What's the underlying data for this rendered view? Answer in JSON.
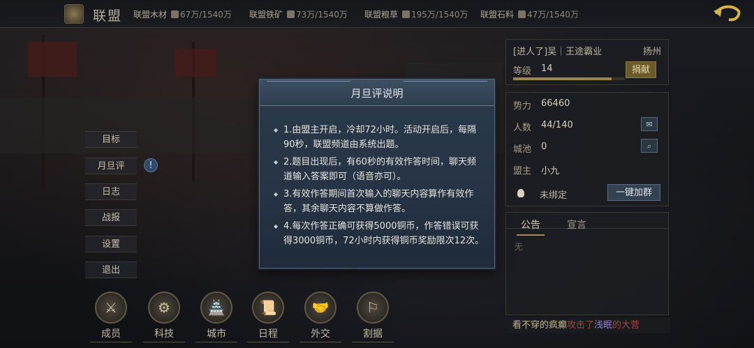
{
  "header": {
    "title": "联盟",
    "resources": [
      {
        "name": "联盟木材",
        "value": "67万/1540万",
        "icon": "wood-icon"
      },
      {
        "name": "联盟铁矿",
        "value": "73万/1540万",
        "icon": "iron-icon"
      },
      {
        "name": "联盟粮草",
        "value": "195万/1540万",
        "icon": "grain-icon"
      },
      {
        "name": "联盟石料",
        "value": "47万/1540万",
        "icon": "stone-icon"
      }
    ]
  },
  "left_menu": [
    "目标",
    "月旦评",
    "日志",
    "战报",
    "设置",
    "退出"
  ],
  "help_bubble": "!",
  "bottom_nav": [
    {
      "label": "成员",
      "glyph": "⚔"
    },
    {
      "label": "科技",
      "glyph": "⚙"
    },
    {
      "label": "城市",
      "glyph": "🏯"
    },
    {
      "label": "日程",
      "glyph": "📜"
    },
    {
      "label": "外交",
      "glyph": "🤝"
    },
    {
      "label": "割据",
      "glyph": "⚐"
    }
  ],
  "alliance": {
    "name": "[进人了]吴｜王途霸业",
    "city": "扬州",
    "level_label": "等级",
    "level": "14",
    "level_progress": 0.88,
    "donate": "捐献",
    "power_label": "势力",
    "power": "66460",
    "members_label": "人数",
    "members": "44/140",
    "cities_label": "城池",
    "cities": "0",
    "leader_label": "盟主",
    "leader": "小九",
    "qq_status": "未绑定",
    "join_group": "一键加群"
  },
  "tabs": {
    "notice": "公告",
    "declaration": "宣言",
    "notice_content": "无"
  },
  "ticker": {
    "attacker": "看不穿的疯癫",
    "action": "攻击了",
    "target": "浅眠",
    "suffix": "的大营"
  },
  "modal": {
    "title": "月旦评说明",
    "rules": [
      "1.由盟主开启，冷却72小时。活动开启后，每隔90秒，联盟频道由系统出题。",
      "2.题目出现后，有60秒的有效作答时间，聊天频道输入答案即可（语音亦可）。",
      "3.有效作答期间首次输入的聊天内容算作有效作答，其余聊天内容不算做作答。",
      "4.每次作答正确可获得5000铜币，作答错误可获得3000铜币，72小时内获得铜币奖励限次12次。"
    ]
  },
  "colors": {
    "accent_gold": "#a08c5c",
    "modal_bg": "#263445",
    "ticker_red": "#9a4a40",
    "ticker_purple": "#8e80c8"
  }
}
